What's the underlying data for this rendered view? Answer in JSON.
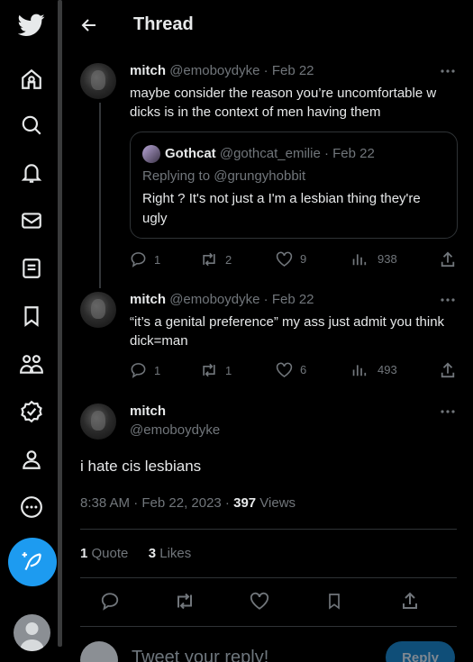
{
  "nav": {
    "icons": [
      "twitter-logo-icon",
      "home-icon",
      "explore-icon",
      "notifications-icon",
      "messages-icon",
      "lists-icon",
      "bookmarks-icon",
      "communities-icon",
      "verified-icon",
      "profile-icon",
      "more-icon"
    ],
    "tweet_button_icon": "compose-feather-icon"
  },
  "header": {
    "title": "Thread",
    "back_icon": "arrow-left-icon"
  },
  "tweets": [
    {
      "name": "mitch",
      "handle": "@emoboydyke",
      "date": "Feb 22",
      "text": "maybe consider the reason you’re uncomfortable w dicks is in the context of men having them",
      "quote": {
        "name": "Gothcat",
        "handle": "@gothcat_emilie",
        "date": "Feb 22",
        "replying": "Replying to @grungyhobbit",
        "text": "Right ? It's not just a I'm a lesbian thing they're ugly"
      },
      "replies": "1",
      "retweets": "2",
      "likes": "9",
      "views": "938"
    },
    {
      "name": "mitch",
      "handle": "@emoboydyke",
      "date": "Feb 22",
      "text": "“it’s a genital preference” my ass just admit you think dick=man",
      "replies": "1",
      "retweets": "1",
      "likes": "6",
      "views": "493"
    }
  ],
  "focus": {
    "name": "mitch",
    "handle": "@emoboydyke",
    "text": "i hate cis lesbians",
    "time": "8:38 AM · Feb 22, 2023 · ",
    "views_count": "397",
    "views_label": " Views",
    "quotes_count": "1",
    "quotes_label": " Quote",
    "likes_count": "3",
    "likes_label": " Likes"
  },
  "reply_box": {
    "placeholder": "Tweet your reply!",
    "button": "Reply"
  },
  "colors": {
    "accent": "#1d9bf0",
    "background": "#000000",
    "muted": "#71767b",
    "text": "#e7e9ea"
  }
}
